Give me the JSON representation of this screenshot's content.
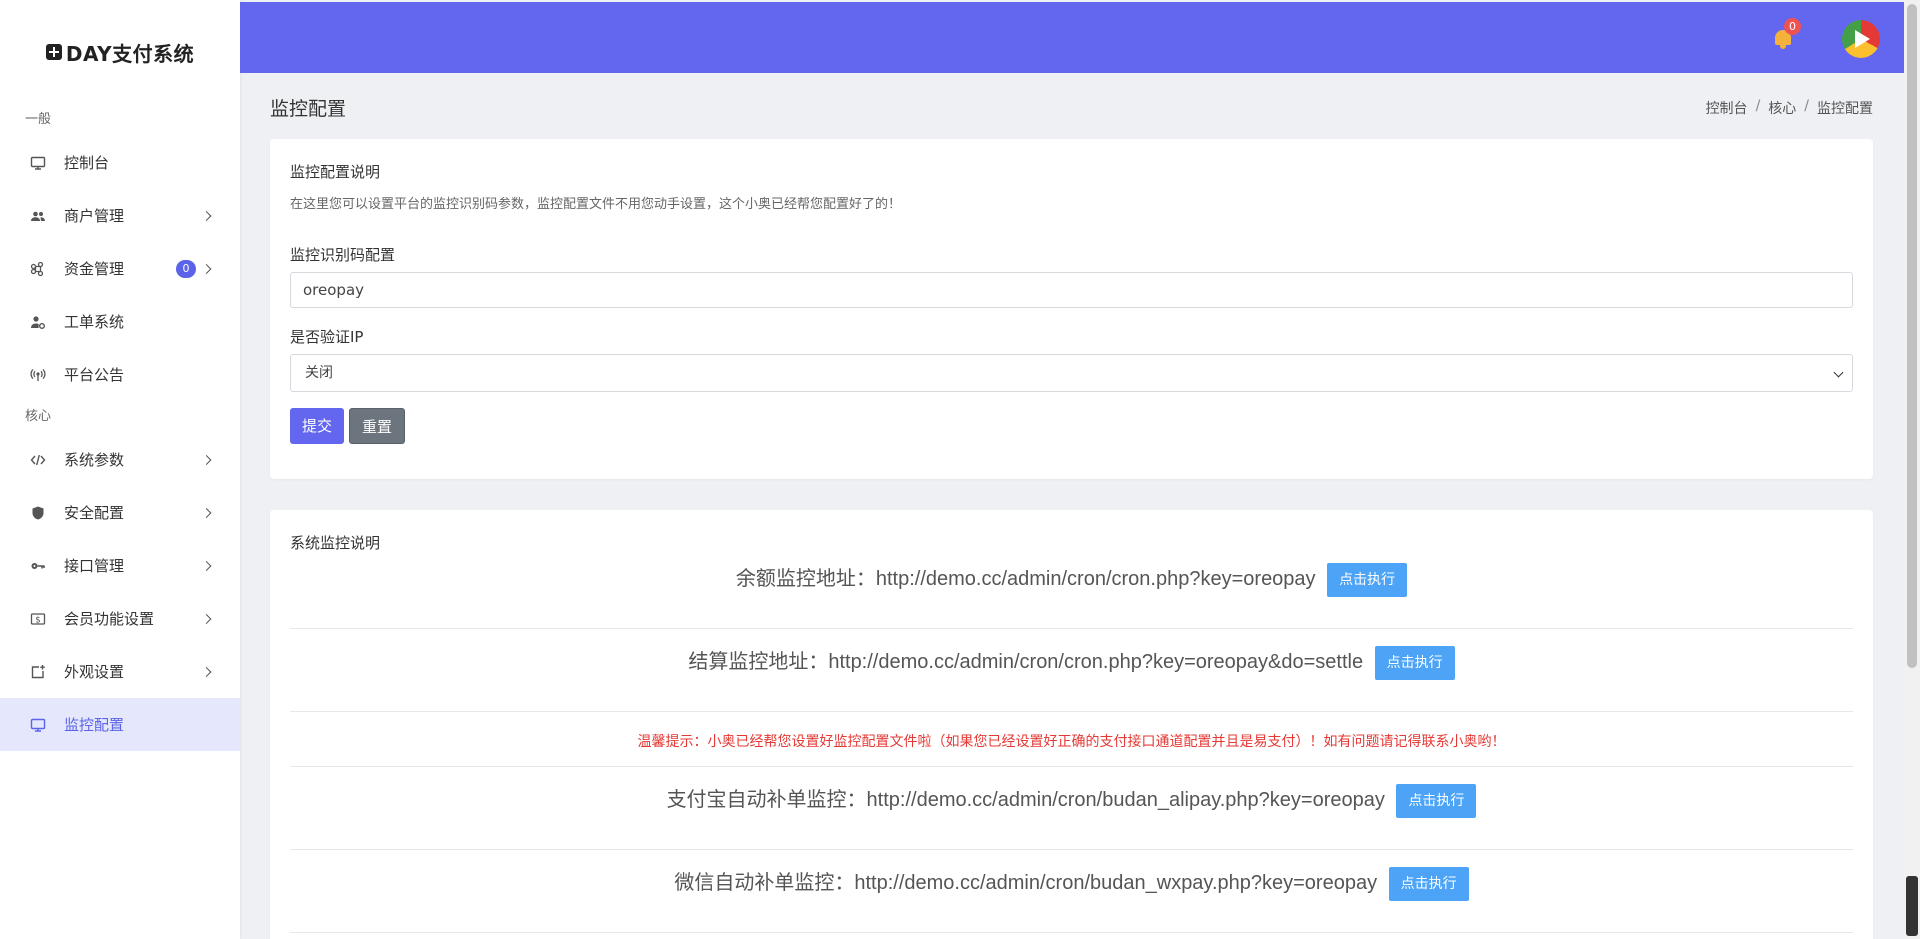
{
  "brand": {
    "name": "DAY支付系统"
  },
  "sidebar": {
    "section_general": "一般",
    "section_core": "核心",
    "items": [
      {
        "label": "控制台",
        "icon": "monitor-icon"
      },
      {
        "label": "商户管理",
        "icon": "users-icon"
      },
      {
        "label": "资金管理",
        "icon": "command-icon",
        "badge": "0"
      },
      {
        "label": "工单系统",
        "icon": "user-gear-icon"
      },
      {
        "label": "平台公告",
        "icon": "broadcast-icon"
      },
      {
        "label": "系统参数",
        "icon": "code-icon"
      },
      {
        "label": "安全配置",
        "icon": "shield-icon"
      },
      {
        "label": "接口管理",
        "icon": "key-icon"
      },
      {
        "label": "会员功能设置",
        "icon": "dollar-icon"
      },
      {
        "label": "外观设置",
        "icon": "add-screen-icon"
      },
      {
        "label": "监控配置",
        "icon": "monitor-icon"
      }
    ]
  },
  "topbar": {
    "notification_count": "0"
  },
  "page": {
    "title": "监控配置",
    "breadcrumb": [
      "控制台",
      "核心",
      "监控配置"
    ]
  },
  "config_card": {
    "title": "监控配置说明",
    "description": "在这里您可以设置平台的监控识别码参数，监控配置文件不用您动手设置，这个小奥已经帮您配置好了的！",
    "key_label": "监控识别码配置",
    "key_value": "oreopay",
    "verify_ip_label": "是否验证IP",
    "verify_ip_value": "关闭",
    "submit_label": "提交",
    "reset_label": "重置"
  },
  "monitor_card": {
    "title": "系统监控说明",
    "exec_label": "点击执行",
    "balance": "余额监控地址：http://demo.cc/admin/cron/cron.php?key=oreopay",
    "settle": "结算监控地址：http://demo.cc/admin/cron/cron.php?key=oreopay&do=settle",
    "warning": "温馨提示：小奥已经帮您设置好监控配置文件啦（如果您已经设置好正确的支付接口通道配置并且是易支付）！如有问题请记得联系小奥哟！",
    "alipay": "支付宝自动补单监控：http://demo.cc/admin/cron/budan_alipay.php?key=oreopay",
    "wxpay": "微信自动补单监控：http://demo.cc/admin/cron/budan_wxpay.php?key=oreopay"
  },
  "colors": {
    "accent": "#6366ee",
    "exec_button": "#4da3f5",
    "warning": "#e53935"
  }
}
